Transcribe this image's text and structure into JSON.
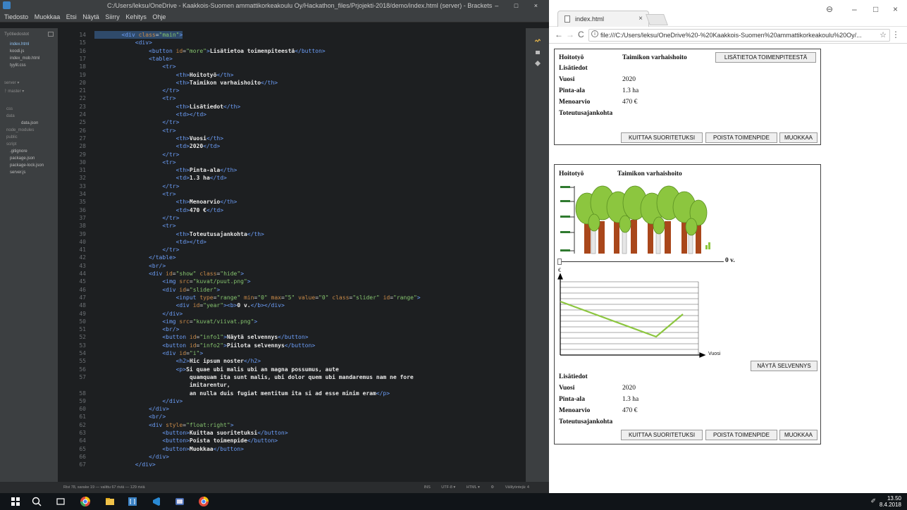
{
  "brackets": {
    "title": "C:/Users/leksu/OneDrive - Kaakkois-Suomen ammattikorkeakoulu Oy/Hackathon_files/Prjojekti-2018/demo/index.html (server) - Brackets",
    "window_controls": "– □ ×",
    "menu": [
      "Tiedosto",
      "Muokkaa",
      "Etsi",
      "Näytä",
      "Siirry",
      "Kehitys",
      "Ohje"
    ],
    "sidebar": {
      "header": "Työtiedostot",
      "working_files": [
        "index.html",
        "koodi.js",
        "index_mob.html",
        "tyylit.css"
      ],
      "project_name": "server",
      "branch": "master",
      "tree": [
        {
          "label": "css",
          "kind": "folder"
        },
        {
          "label": "data",
          "kind": "folder"
        },
        {
          "label": "data.json",
          "kind": "sub"
        },
        {
          "label": "node_modules",
          "kind": "folder-dim"
        },
        {
          "label": "public",
          "kind": "folder"
        },
        {
          "label": "script",
          "kind": "folder"
        },
        {
          "label": ".gitignore",
          "kind": "file"
        },
        {
          "label": "package.json",
          "kind": "file"
        },
        {
          "label": "package-lock.json",
          "kind": "file"
        },
        {
          "label": "server.js",
          "kind": "file"
        }
      ]
    },
    "code": [
      {
        "n": "14",
        "text": "        <div class=\"main\">",
        "sel": true
      },
      {
        "n": "15",
        "text": "            <div>"
      },
      {
        "n": "16",
        "text": "                <button id=\"more\">Lisätietoa toimenpiteestä</button>"
      },
      {
        "n": "17",
        "text": "                <table>"
      },
      {
        "n": "18",
        "text": "                    <tr>"
      },
      {
        "n": "19",
        "text": "                        <th>Hoitotyö</th>"
      },
      {
        "n": "20",
        "text": "                        <th>Taimikon varhaishoito</th>"
      },
      {
        "n": "21",
        "text": "                    </tr>"
      },
      {
        "n": "22",
        "text": "                    <tr>"
      },
      {
        "n": "23",
        "text": "                        <th>Lisätiedot</th>"
      },
      {
        "n": "24",
        "text": "                        <td></td>"
      },
      {
        "n": "25",
        "text": "                    </tr>"
      },
      {
        "n": "26",
        "text": "                    <tr>"
      },
      {
        "n": "27",
        "text": "                        <th>Vuosi</th>"
      },
      {
        "n": "28",
        "text": "                        <td>2020</td>"
      },
      {
        "n": "29",
        "text": "                    </tr>"
      },
      {
        "n": "30",
        "text": "                    <tr>"
      },
      {
        "n": "31",
        "text": "                        <th>Pinta-ala</th>"
      },
      {
        "n": "32",
        "text": "                        <td>1.3 ha</td>"
      },
      {
        "n": "33",
        "text": "                    </tr>"
      },
      {
        "n": "34",
        "text": "                    <tr>"
      },
      {
        "n": "35",
        "text": "                        <th>Menoarvio</th>"
      },
      {
        "n": "36",
        "text": "                        <td>470 €</td>"
      },
      {
        "n": "37",
        "text": "                    </tr>"
      },
      {
        "n": "38",
        "text": "                    <tr>"
      },
      {
        "n": "39",
        "text": "                        <th>Toteutusajankohta</th>"
      },
      {
        "n": "40",
        "text": "                        <td></td>"
      },
      {
        "n": "41",
        "text": "                    </tr>"
      },
      {
        "n": "42",
        "text": "                </table>"
      },
      {
        "n": "43",
        "text": "                <br/>"
      },
      {
        "n": "44",
        "text": "                <div id=\"show\" class=\"hide\">"
      },
      {
        "n": "45",
        "text": "                    <img src=\"kuvat/puut.png\">"
      },
      {
        "n": "46",
        "text": "                    <div id=\"slider\">"
      },
      {
        "n": "47",
        "text": "                        <input type=\"range\" min=\"0\" max=\"5\" value=\"0\" class=\"slider\" id=\"range\">"
      },
      {
        "n": "48",
        "text": "                        <div id=\"year\"><b>0 v.</b></div>"
      },
      {
        "n": "49",
        "text": "                    </div>"
      },
      {
        "n": "50",
        "text": "                    <img src=\"kuvat/viivat.png\">"
      },
      {
        "n": "51",
        "text": "                    <br/>"
      },
      {
        "n": "52",
        "text": "                    <button id=\"info1\">Näytä selvennys</button>"
      },
      {
        "n": "53",
        "text": "                    <button id=\"info2\">Piilota selvennys</button>"
      },
      {
        "n": "54",
        "text": "                    <div id=\"i\">"
      },
      {
        "n": "55",
        "text": "                        <h2>Hic ipsum noster</h2>"
      },
      {
        "n": "56",
        "text": "                        <p>Si quae ubi malis ubi an magna possumus, aute"
      },
      {
        "n": "57",
        "text": "                            quamquam ita sunt malis, ubi dolor quem ubi mandaremus nam ne fore"
      },
      {
        "n": "",
        "text": "                            imitarentur,"
      },
      {
        "n": "58",
        "text": "                            an nulla duis fugiat mentitum ita si ad esse minim eram</p>"
      },
      {
        "n": "59",
        "text": "                    </div>"
      },
      {
        "n": "60",
        "text": "                </div>"
      },
      {
        "n": "61",
        "text": "                <br/>"
      },
      {
        "n": "62",
        "text": "                <div style=\"float:right\">"
      },
      {
        "n": "63",
        "text": "                    <button>Kuittaa suoritetuksi</button>"
      },
      {
        "n": "64",
        "text": "                    <button>Poista toimenpide</button>"
      },
      {
        "n": "65",
        "text": "                    <button>Muokkaa</button>"
      },
      {
        "n": "66",
        "text": "                </div>"
      },
      {
        "n": "67",
        "text": "            </div>"
      }
    ],
    "status": {
      "left": "Rivi 78, sarake 19 — valittu 67 riviä — 129 riviä",
      "right": [
        "INS",
        "UTF-8 ▾",
        "HTML ▾",
        "⚙",
        "Välilyöntejä: 4"
      ]
    }
  },
  "chrome": {
    "tab_title": "index.html",
    "tab_close": "×",
    "window_controls": {
      "account": "⊖",
      "minimize": "–",
      "maximize": "□",
      "close": "×"
    },
    "url": "file:///C:/Users/leksu/OneDrive%20-%20Kaakkois-Suomen%20ammattikorkeakoulu%20Oy/...",
    "page": {
      "panel1": {
        "th_hoitotyo": "Hoitotyö",
        "hoitotyo_value": "Taimikon varhaishoito",
        "more_button": "LISÄTIETOA TOIMENPITEESTÄ",
        "rows": [
          {
            "label": "Lisätiedot",
            "value": ""
          },
          {
            "label": "Vuosi",
            "value": "2020"
          },
          {
            "label": "Pinta-ala",
            "value": "1.3 ha"
          },
          {
            "label": "Menoarvio",
            "value": "470 €"
          },
          {
            "label": "Toteutusajankohta",
            "value": ""
          }
        ],
        "actions": [
          "KUITTAA SUORITETUKSI",
          "POISTA TOIMENPIDE",
          "MUOKKAA"
        ]
      },
      "panel2": {
        "th_hoitotyo": "Hoitotyö",
        "hoitotyo_value": "Taimikon varhaishoito",
        "year_label": "0 v.",
        "slider": {
          "min": 0,
          "max": 5,
          "value": 0
        },
        "chart_y_label": "€",
        "chart_x_label": "Vuosi",
        "show_button": "NÄYTÄ SELVENNYS",
        "rows": [
          {
            "label": "Lisätiedot",
            "value": ""
          },
          {
            "label": "Vuosi",
            "value": "2020"
          },
          {
            "label": "Pinta-ala",
            "value": "1.3 ha"
          },
          {
            "label": "Menoarvio",
            "value": "470 €"
          },
          {
            "label": "Toteutusajankohta",
            "value": ""
          }
        ],
        "actions": [
          "KUITTAA SUORITETUKSI",
          "POISTA TOIMENPIDE",
          "MUOKKAA"
        ]
      }
    }
  },
  "taskbar": {
    "time": "13.50",
    "date": "8.4.2018"
  },
  "colors": {
    "editor_bg": "#1d1f21",
    "tag": "#6c9ef8",
    "attr": "#c98a48",
    "string": "#85c36e",
    "chart_line": "#8cc63f"
  }
}
